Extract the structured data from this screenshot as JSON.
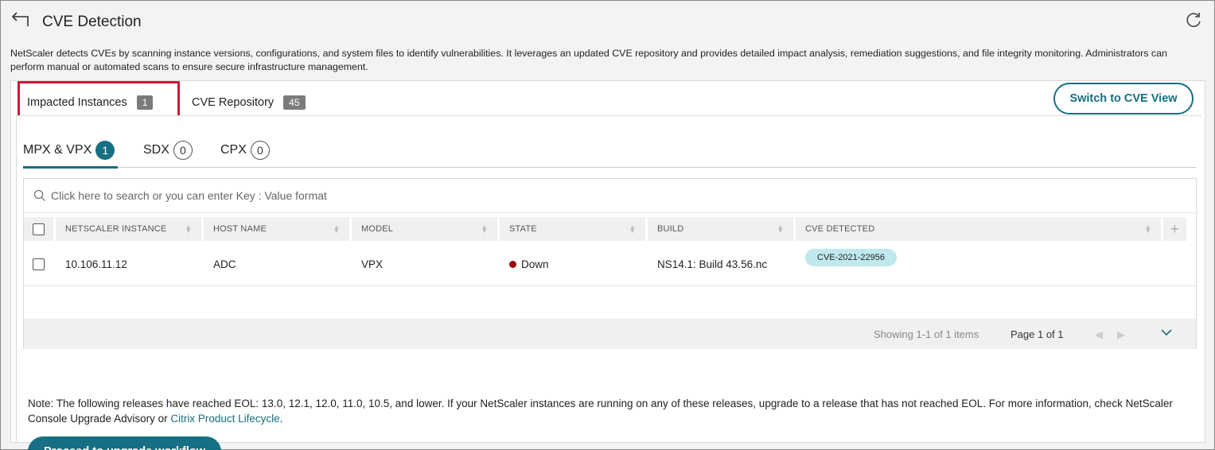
{
  "header": {
    "title": "CVE Detection"
  },
  "description": "NetScaler detects CVEs by scanning instance versions, configurations, and system files to identify vulnerabilities. It leverages an updated CVE repository and provides detailed impact analysis, remediation suggestions, and file integrity monitoring. Administrators can perform manual or automated scans to ensure secure infrastructure management.",
  "top_tabs": [
    {
      "label": "Impacted Instances",
      "count": "1"
    },
    {
      "label": "CVE Repository",
      "count": "45"
    }
  ],
  "switch_button": "Switch to CVE View",
  "sub_tabs": [
    {
      "label": "MPX & VPX",
      "count": "1"
    },
    {
      "label": "SDX",
      "count": "0"
    },
    {
      "label": "CPX",
      "count": "0"
    }
  ],
  "search": {
    "placeholder": "Click here to search or you can enter Key : Value format"
  },
  "table": {
    "columns": [
      "NETSCALER INSTANCE",
      "HOST NAME",
      "MODEL",
      "STATE",
      "BUILD",
      "CVE DETECTED"
    ],
    "add_column": "+",
    "rows": [
      {
        "instance": "10.106.11.12",
        "host": "ADC",
        "model": "VPX",
        "state": "Down",
        "build": "NS14.1: Build 43.56.nc",
        "cve": "CVE-2021-22956"
      }
    ],
    "state_color": "#a00000"
  },
  "pagination": {
    "showing": "Showing 1-1 of 1 items",
    "page": "Page 1 of 1",
    "prev": "◀",
    "next": "▶"
  },
  "note": {
    "text": "Note: The following releases have reached EOL: 13.0, 12.1, 12.0, 11.0, 10.5, and lower. If your NetScaler instances are running on any of these releases, upgrade to a release that has not reached EOL. For more information, check NetScaler Console Upgrade Advisory or ",
    "link": "Citrix Product Lifecycle",
    "end": "."
  },
  "upgrade_button": "Proceed to upgrade workflow",
  "colors": {
    "accent": "#166f82",
    "highlight": "#d0173a",
    "pill": "#bfe9ec"
  }
}
